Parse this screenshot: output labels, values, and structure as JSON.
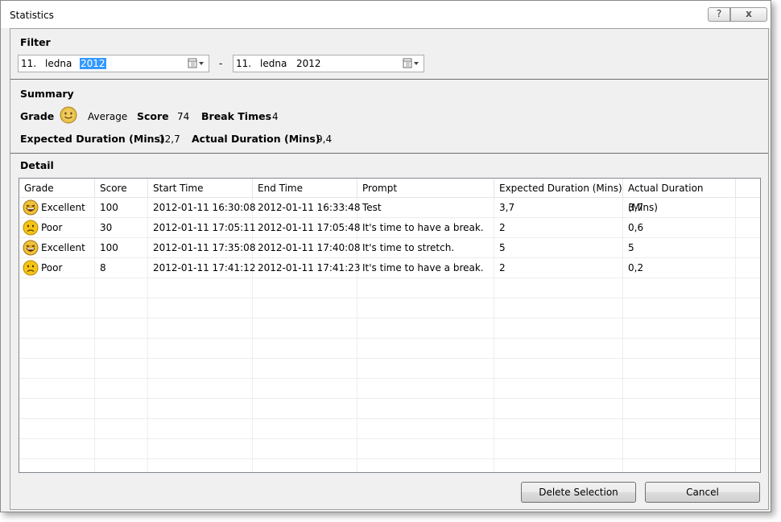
{
  "window": {
    "title": "Statistics",
    "help_label": "?",
    "close_label": "x"
  },
  "filter": {
    "heading": "Filter",
    "from": {
      "day": "11.",
      "month": "ledna",
      "year": "2012"
    },
    "separator": "-",
    "to": {
      "day": "11.",
      "month": "ledna",
      "year": "2012"
    }
  },
  "summary": {
    "heading": "Summary",
    "grade_label": "Grade",
    "grade_icon": "smile-face-icon",
    "grade_value": "Average",
    "score_label": "Score",
    "score_value": "74",
    "break_times_label": "Break Times",
    "break_times_value": "4",
    "expected_label": "Expected Duration (Mins)",
    "expected_value": "12,7",
    "actual_label": "Actual Duration (Mins)",
    "actual_value": "9,4"
  },
  "detail": {
    "heading": "Detail",
    "columns": [
      "Grade",
      "Score",
      "Start Time",
      "End Time",
      "Prompt",
      "Expected Duration (Mins)",
      "Actual Duration (Mins)"
    ],
    "rows": [
      {
        "grade": "Excellent",
        "icon": "laughing-face-icon",
        "score": "100",
        "start": "2012-01-11 16:30:08",
        "end": "2012-01-11 16:33:48",
        "prompt": "Test",
        "expected": "3,7",
        "actual": "3,7"
      },
      {
        "grade": "Poor",
        "icon": "sad-face-icon",
        "score": "30",
        "start": "2012-01-11 17:05:11",
        "end": "2012-01-11 17:05:48",
        "prompt": "It's time to have a break.",
        "expected": "2",
        "actual": "0,6"
      },
      {
        "grade": "Excellent",
        "icon": "laughing-face-icon",
        "score": "100",
        "start": "2012-01-11 17:35:08",
        "end": "2012-01-11 17:40:08",
        "prompt": "It's time to stretch.",
        "expected": "5",
        "actual": "5"
      },
      {
        "grade": "Poor",
        "icon": "sad-face-icon",
        "score": "8",
        "start": "2012-01-11 17:41:12",
        "end": "2012-01-11 17:41:23",
        "prompt": "It's time to have a break.",
        "expected": "2",
        "actual": "0,2"
      }
    ]
  },
  "buttons": {
    "delete_label": "Delete Selection",
    "cancel_label": "Cancel"
  }
}
